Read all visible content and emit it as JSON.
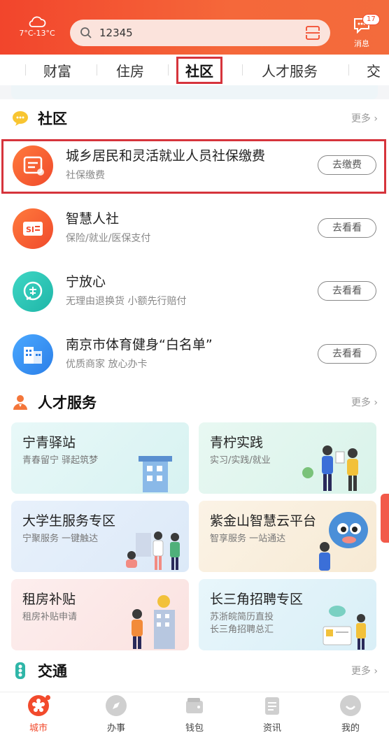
{
  "header": {
    "weather": "7°C-13°C",
    "search_query": "12345",
    "message_badge": "17",
    "message_label": "消息"
  },
  "tabs": [
    {
      "label": "财富"
    },
    {
      "label": "住房"
    },
    {
      "label": "社区"
    },
    {
      "label": "人才服务"
    },
    {
      "label": "交"
    }
  ],
  "community": {
    "title": "社区",
    "more": "更多",
    "items": [
      {
        "title": "城乡居民和灵活就业人员社保缴费",
        "subtitle": "社保缴费",
        "button": "去缴费",
        "icon": "social-security-payment-icon"
      },
      {
        "title": "智慧人社",
        "subtitle": "保险/就业/医保支付",
        "button": "去看看",
        "icon": "si-card-icon"
      },
      {
        "title": "宁放心",
        "subtitle": "无理由退换货 小额先行赔付",
        "button": "去看看",
        "icon": "ning-shield-icon"
      },
      {
        "title": "南京市体育健身“白名单”",
        "subtitle": "优质商家 放心办卡",
        "button": "去看看",
        "icon": "gym-building-icon"
      }
    ]
  },
  "talent": {
    "title": "人才服务",
    "more": "更多",
    "tiles": [
      {
        "title": "宁青驿站",
        "subtitle": "青春留宁 驿起筑梦"
      },
      {
        "title": "青柠实践",
        "subtitle": "实习/实践/就业"
      },
      {
        "title": "大学生服务专区",
        "subtitle": "宁聚服务 一键触达"
      },
      {
        "title": "紫金山智慧云平台",
        "subtitle": "智享服务 一站通达"
      },
      {
        "title": "租房补贴",
        "subtitle": "租房补贴申请"
      },
      {
        "title": "长三角招聘专区",
        "subtitle": "苏浙皖简历直投",
        "subtitle2": "长三角招聘总汇"
      }
    ]
  },
  "traffic": {
    "title": "交通",
    "more": "更多"
  },
  "bottom_nav": [
    {
      "label": "城市",
      "active": true
    },
    {
      "label": "办事"
    },
    {
      "label": "钱包"
    },
    {
      "label": "资讯"
    },
    {
      "label": "我的"
    }
  ],
  "colors": {
    "brand": "#f24a2c",
    "highlight": "#d6343c"
  }
}
